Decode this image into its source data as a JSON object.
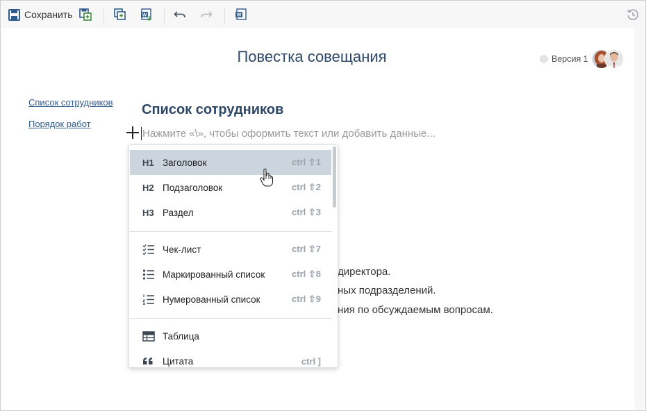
{
  "toolbar": {
    "save_label": "Сохранить",
    "buttons": [
      "save-icon",
      "save-as-icon",
      "copy-icon",
      "export-word-icon",
      "undo-icon",
      "redo-icon",
      "word-icon",
      "history-icon"
    ]
  },
  "document": {
    "title": "Повестка совещания",
    "version_label": "Версия 1",
    "section_heading": "Список сотрудников",
    "placeholder": "Нажмите «\\», чтобы оформить текст или добавить данные...",
    "body_lines": [
      "директора.",
      "ных  подразделений.",
      "ния по обсуждаемым вопросам."
    ]
  },
  "toc": {
    "items": [
      "Список сотрудников",
      "Порядок работ"
    ]
  },
  "insert_menu": {
    "groups": [
      [
        {
          "icon": "H1",
          "label": "Заголовок",
          "shortcut": "ctrl ⇧1",
          "active": true
        },
        {
          "icon": "H2",
          "label": "Подзаголовок",
          "shortcut": "ctrl ⇧2"
        },
        {
          "icon": "H3",
          "label": "Раздел",
          "shortcut": "ctrl ⇧3"
        }
      ],
      [
        {
          "icon": "checklist-icon",
          "label": "Чек-лист",
          "shortcut": "ctrl ⇧7"
        },
        {
          "icon": "bulleted-list-icon",
          "label": "Маркированный список",
          "shortcut": "ctrl ⇧8"
        },
        {
          "icon": "numbered-list-icon",
          "label": "Нумерованный список",
          "shortcut": "ctrl ⇧9"
        }
      ],
      [
        {
          "icon": "table-icon",
          "label": "Таблица",
          "shortcut": ""
        },
        {
          "icon": "quote-icon",
          "label": "Цитата",
          "shortcut": "ctrl ]"
        }
      ]
    ]
  },
  "colors": {
    "accent": "#2f5b8e",
    "title": "#2e4868",
    "active_item": "#ccd5dd",
    "toolbar_bg": "#f7f7f7"
  }
}
